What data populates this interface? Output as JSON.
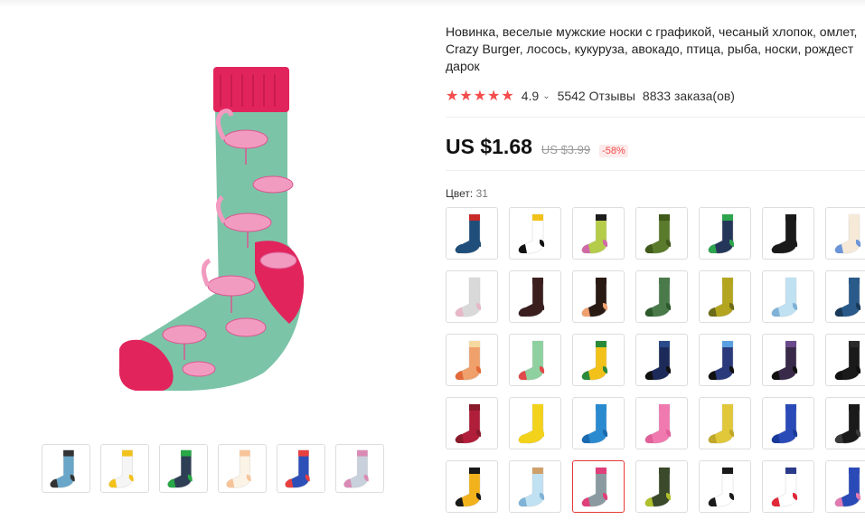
{
  "product": {
    "title_lines": [
      "Новинка, веселые мужские носки с графикой, чесаный хлопок, омлет,",
      "Crazy Burger, лосось, кукуруза, авокадо, птица, рыба, носки, рождест",
      "дарок"
    ],
    "rating": {
      "stars_count": 5,
      "score": "4.9",
      "reviews": "5542 Отзывы",
      "orders": "8833 заказа(ов)"
    },
    "price": {
      "current": "US $1.68",
      "old": "US $3.99",
      "discount": "-58%"
    },
    "color": {
      "label": "Цвет:",
      "count": "31"
    }
  },
  "colors": {
    "star": "#f44b4b",
    "price_discount": "#f44b4b",
    "selected_border": "#e53935",
    "main_sock_body": "#7cc4a8",
    "main_sock_accent": "#e2245d"
  },
  "gallery": {
    "thumbnails": [
      {
        "name": "multi",
        "body": "#6aa6c8",
        "accent": "#333333"
      },
      {
        "name": "eggs",
        "body": "#f5f5f5",
        "accent": "#f2c21b"
      },
      {
        "name": "dots",
        "body": "#2e3f55",
        "accent": "#27a745"
      },
      {
        "name": "birds",
        "body": "#fbf3e6",
        "accent": "#f7c49a"
      },
      {
        "name": "blue",
        "body": "#2d4fb8",
        "accent": "#e84040"
      },
      {
        "name": "trio",
        "body": "#c8d0dc",
        "accent": "#d98bb5"
      }
    ]
  },
  "swatches": [
    [
      {
        "body": "#1f4e7a",
        "top": "#c92a2a",
        "heel": "#1f4e7a"
      },
      {
        "body": "#ffffff",
        "top": "#f2c21b",
        "heel": "#111111"
      },
      {
        "body": "#b5cc4a",
        "top": "#1d1d1d",
        "heel": "#d06aa6"
      },
      {
        "body": "#5a7a2c",
        "top": "#3f5a1a",
        "heel": "#3f5a1a"
      },
      {
        "body": "#24375a",
        "top": "#2da44e",
        "heel": "#2da44e"
      },
      {
        "body": "#1a1a1a",
        "top": "#1a1a1a",
        "heel": "#1a1a1a"
      },
      {
        "body": "#f6e9d8",
        "top": "#f6e9d8",
        "heel": "#6b95d8"
      }
    ],
    [
      {
        "body": "#d9d9d9",
        "top": "#d9d9d9",
        "heel": "#e6b8c8"
      },
      {
        "body": "#3b1f1f",
        "top": "#3b1f1f",
        "heel": "#3b1f1f"
      },
      {
        "body": "#2a1a14",
        "top": "#2a1a14",
        "heel": "#f0a070"
      },
      {
        "body": "#4a7a4a",
        "top": "#4a7a4a",
        "heel": "#2d5a2d"
      },
      {
        "body": "#b3a51f",
        "top": "#b3a51f",
        "heel": "#6b6b1a"
      },
      {
        "body": "#bfe1f2",
        "top": "#bfe1f2",
        "heel": "#7fb2d6"
      },
      {
        "body": "#2a5a8a",
        "top": "#2a5a8a",
        "heel": "#1a3a5a"
      }
    ],
    [
      {
        "body": "#f0a06a",
        "top": "#f5d9a0",
        "heel": "#e26a3a"
      },
      {
        "body": "#8fd0a0",
        "top": "#8fd0a0",
        "heel": "#e04a4a"
      },
      {
        "body": "#f2c21b",
        "top": "#2a8a3a",
        "heel": "#2a8a3a"
      },
      {
        "body": "#1c2a5a",
        "top": "#2a4a8a",
        "heel": "#111111"
      },
      {
        "body": "#2a3a7a",
        "top": "#5aa0e0",
        "heel": "#111111"
      },
      {
        "body": "#3a2a4a",
        "top": "#6a4a8a",
        "heel": "#111111"
      },
      {
        "body": "#1a1a1a",
        "top": "#2a2a2a",
        "heel": "#111111"
      }
    ],
    [
      {
        "body": "#b01e3a",
        "top": "#8a1a2a",
        "heel": "#8a1a2a"
      },
      {
        "body": "#f2d21b",
        "top": "#f2d21b",
        "heel": "#f2d21b"
      },
      {
        "body": "#2a8ad0",
        "top": "#2a8ad0",
        "heel": "#1a6ab0"
      },
      {
        "body": "#f07ab0",
        "top": "#f07ab0",
        "heel": "#e0609a"
      },
      {
        "body": "#e0c83a",
        "top": "#e0c83a",
        "heel": "#c0a82a"
      },
      {
        "body": "#2a4ab8",
        "top": "#2a4ab8",
        "heel": "#1a3a9a"
      },
      {
        "body": "#1a1a1a",
        "top": "#1a1a1a",
        "heel": "#3a3a3a"
      }
    ],
    [
      {
        "body": "#f2b21b",
        "top": "#1a1a1a",
        "heel": "#1a1a1a"
      },
      {
        "body": "#bfe1f2",
        "top": "#d0a06a",
        "heel": "#7fb2d6"
      },
      {
        "body": "#8a9aa0",
        "top": "#e0407a",
        "heel": "#e0407a"
      },
      {
        "body": "#3a4a2a",
        "top": "#3a4a2a",
        "heel": "#b0c02a"
      },
      {
        "body": "#ffffff",
        "top": "#1a1a1a",
        "heel": "#1a1a1a"
      },
      {
        "body": "#ffffff",
        "top": "#2a3a8a",
        "heel": "#e02a3a"
      },
      {
        "body": "#2a4ab8",
        "top": "#2a4ab8",
        "heel": "#e07ab0"
      }
    ]
  ],
  "selected_swatch": "row4-col2"
}
